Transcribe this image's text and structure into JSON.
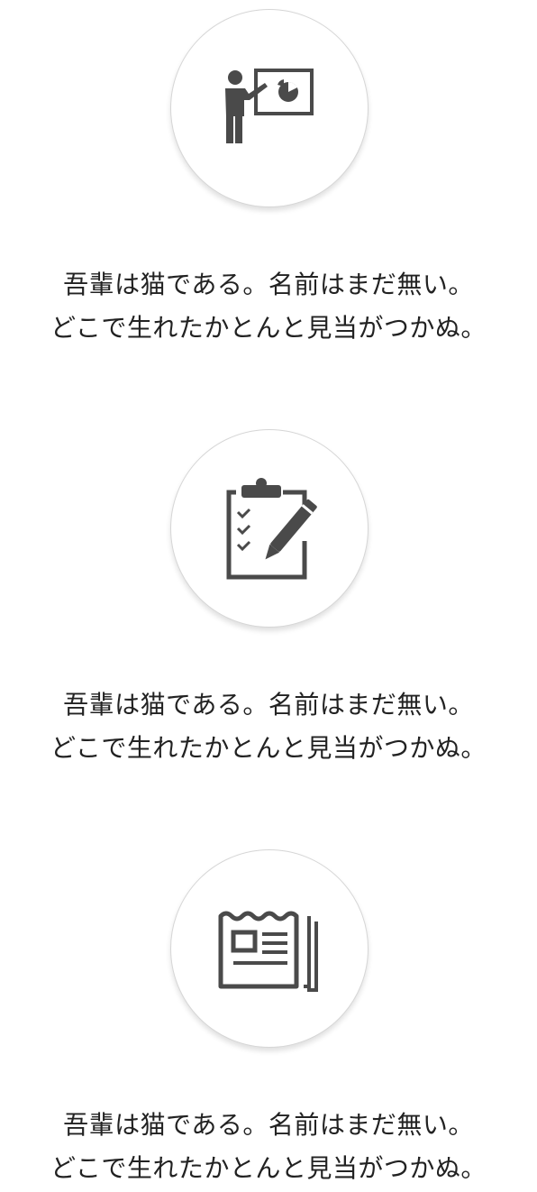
{
  "features": [
    {
      "icon": "presentation-icon",
      "line1": "吾輩は猫である。名前はまだ無い。",
      "line2": "どこで生れたかとんと見当がつかぬ。"
    },
    {
      "icon": "clipboard-checklist-icon",
      "line1": "吾輩は猫である。名前はまだ無い。",
      "line2": "どこで生れたかとんと見当がつかぬ。"
    },
    {
      "icon": "newspaper-icon",
      "line1": "吾輩は猫である。名前はまだ無い。",
      "line2": "どこで生れたかとんと見当がつかぬ。"
    }
  ],
  "colors": {
    "icon": "#4a4a4a",
    "text": "#222222",
    "circle_border": "#d6d6d6",
    "background": "#ffffff"
  }
}
